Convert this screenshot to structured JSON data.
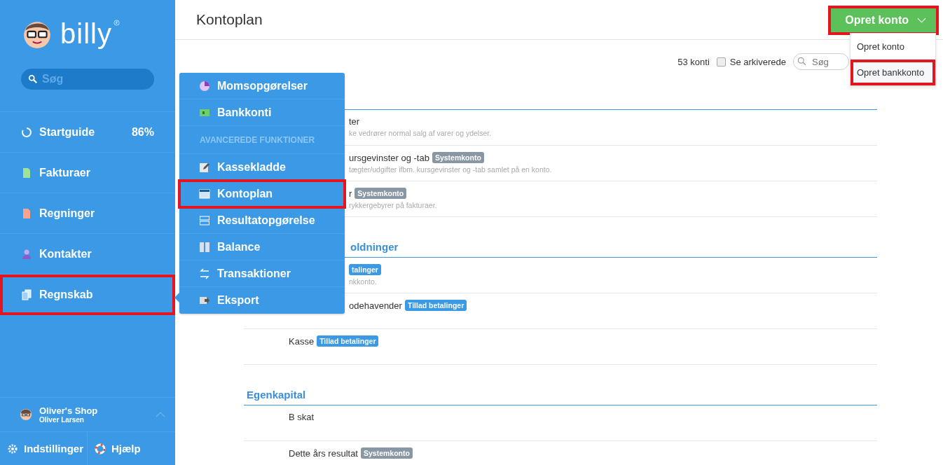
{
  "sidebar": {
    "brand": "billy",
    "search": {
      "placeholder": "Søg"
    },
    "items": [
      {
        "label": "Startguide",
        "value": "86%",
        "highlighted": false
      },
      {
        "label": "Fakturaer",
        "highlighted": false
      },
      {
        "label": "Regninger",
        "highlighted": false
      },
      {
        "label": "Kontakter",
        "highlighted": false
      },
      {
        "label": "Regnskab",
        "highlighted": true
      }
    ],
    "user": {
      "shop": "Oliver's Shop",
      "name": "Oliver Larsen"
    },
    "footer": [
      {
        "label": "Indstillinger"
      },
      {
        "label": "Hjælp"
      }
    ]
  },
  "flyout": {
    "items": [
      {
        "kind": "item",
        "label": "Momsopgørelser",
        "highlighted": false
      },
      {
        "kind": "item",
        "label": "Bankkonti",
        "highlighted": false
      },
      {
        "kind": "header",
        "label": "AVANCEREDE FUNKTIONER"
      },
      {
        "kind": "item",
        "label": "Kassekladde",
        "highlighted": false
      },
      {
        "kind": "item",
        "label": "Kontoplan",
        "highlighted": true
      },
      {
        "kind": "item",
        "label": "Resultatopgørelse",
        "highlighted": false
      },
      {
        "kind": "item",
        "label": "Balance",
        "highlighted": false
      },
      {
        "kind": "item",
        "label": "Transaktioner",
        "highlighted": false
      },
      {
        "kind": "item",
        "label": "Eksport",
        "highlighted": false
      }
    ]
  },
  "page": {
    "title": "Kontoplan",
    "create_button": {
      "label": "Opret konto",
      "highlighted": true
    },
    "create_menu": [
      {
        "label": "Opret konto",
        "highlighted": false
      },
      {
        "label": "Opret bankkonto",
        "highlighted": true
      }
    ],
    "count": "53 konti",
    "archived": {
      "label": "Se arkiverede",
      "checked": false
    },
    "search": {
      "placeholder": "Søg"
    }
  },
  "sections": [
    {
      "kind": "partial",
      "rows": [
        {
          "kind": "partial",
          "name": "ter",
          "description": "ke vedrører normal salg af varer og ydelser."
        },
        {
          "kind": "partial",
          "name": "ursgevinster og -tab",
          "badge": {
            "kind": "system",
            "label": "Systemkonto"
          },
          "description": "tægter/udgifter ifbm. kursgevinster og -tab samlet på en konto."
        },
        {
          "kind": "partial",
          "name": "r",
          "badge": {
            "kind": "system",
            "label": "Systemkonto"
          },
          "description": "rykkergebyrer på fakturaer."
        }
      ]
    },
    {
      "kind": "partial",
      "heading": "oldninger",
      "rows": [
        {
          "kind": "partial",
          "badge": {
            "kind": "payments",
            "label": "talinger"
          },
          "description": "nkkonto."
        },
        {
          "kind": "partial",
          "name": "odehavender",
          "badge": {
            "kind": "payments",
            "label": "Tillad betalinger"
          }
        },
        {
          "kind": "full",
          "name": "Kasse",
          "badge": {
            "kind": "payments",
            "label": "Tillad betalinger"
          }
        }
      ]
    },
    {
      "kind": "full",
      "heading": "Egenkapital",
      "rows": [
        {
          "kind": "full",
          "name": "B skat"
        },
        {
          "kind": "full",
          "name": "Dette års resultat",
          "badge": {
            "kind": "system",
            "label": "Systemkonto"
          }
        }
      ]
    }
  ]
}
